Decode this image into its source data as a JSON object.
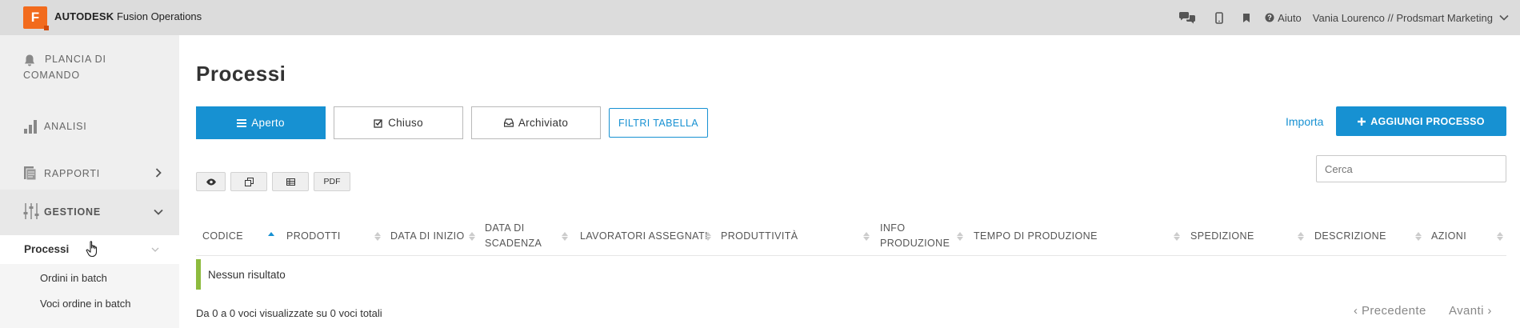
{
  "header": {
    "logo_letter": "F",
    "brand_bold": "AUTODESK",
    "brand_rest": "Fusion Operations",
    "help_label": "Aiuto",
    "user_label": "Vania Lourenco // Prodsmart Marketing",
    "icons": [
      "chat-icon",
      "mobile-icon",
      "bookmark-icon",
      "question-icon",
      "chevron-down-icon"
    ]
  },
  "sidebar": {
    "items": [
      {
        "label_line1": "PLANCIA DI",
        "label_line2": "COMANDO",
        "icon": "bell-icon"
      },
      {
        "label": "ANALISI",
        "icon": "bar-chart-icon"
      },
      {
        "label": "RAPPORTI",
        "icon": "report-icon",
        "chevron": "chevron-right-icon"
      },
      {
        "label": "GESTIONE",
        "icon": "sliders-icon",
        "chevron": "chevron-down-icon"
      }
    ],
    "sub_items": [
      {
        "label": "Processi",
        "active": true
      },
      {
        "label": "Ordini in batch"
      },
      {
        "label": "Voci ordine in batch"
      }
    ]
  },
  "main": {
    "title": "Processi",
    "tabs": [
      {
        "label": "Aperto",
        "icon": "list-icon",
        "active": true
      },
      {
        "label": "Chiuso",
        "icon": "check-square-icon"
      },
      {
        "label": "Archiviato",
        "icon": "inbox-icon"
      }
    ],
    "filter_label": "FILTRI TABELLA",
    "import_label": "Importa",
    "add_label": "AGGIUNGI PROCESSO",
    "tool_buttons": [
      {
        "name": "eye-icon"
      },
      {
        "name": "copy-icon"
      },
      {
        "name": "table-icon"
      },
      {
        "label": "PDF"
      }
    ],
    "search_placeholder": "Cerca",
    "columns": [
      {
        "line1": "CODICE",
        "line2": "",
        "sort": "asc"
      },
      {
        "line1": "PRODOTTI",
        "line2": ""
      },
      {
        "line1": "DATA DI INIZIO",
        "line2": ""
      },
      {
        "line1": "DATA DI",
        "line2": "SCADENZA"
      },
      {
        "line1": "LAVORATORI ASSEGNATI",
        "line2": ""
      },
      {
        "line1": "PRODUTTIVITÀ",
        "line2": ""
      },
      {
        "line1": "INFO",
        "line2": "PRODUZIONE"
      },
      {
        "line1": "TEMPO DI PRODUZIONE",
        "line2": ""
      },
      {
        "line1": "SPEDIZIONE",
        "line2": ""
      },
      {
        "line1": "DESCRIZIONE",
        "line2": ""
      },
      {
        "line1": "AZIONI",
        "line2": ""
      }
    ],
    "empty_text": "Nessun risultato",
    "info_text": "Da 0 a 0 voci visualizzate su 0 voci totali",
    "prev_label": "‹ Precedente",
    "next_label": "Avanti ›",
    "colors": {
      "primary": "#1791d2",
      "brand": "#f26b1d",
      "empty_marker": "#8dbb3e"
    }
  }
}
